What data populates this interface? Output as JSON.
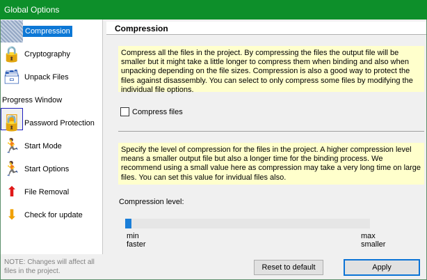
{
  "window": {
    "title": "Global Options"
  },
  "sidebar": {
    "items": [
      {
        "label": "Compression",
        "icon": "compression-icon"
      },
      {
        "label": "Cryptography",
        "icon": "lock-icon"
      },
      {
        "label": "Unpack Files",
        "icon": "unpack-icon"
      },
      {
        "label": "Progress Window",
        "icon": "progress-window-icon"
      },
      {
        "label": "Password Protection",
        "icon": "lock-icon"
      },
      {
        "label": "Start Mode",
        "icon": "running-man-icon"
      },
      {
        "label": "Start Options",
        "icon": "running-man-icon"
      },
      {
        "label": "File Removal",
        "icon": "arrow-up-icon"
      },
      {
        "label": "Check for update",
        "icon": "arrow-down-icon"
      }
    ],
    "selected": "Compression",
    "note": "NOTE: Changes will affect all files in the project."
  },
  "main": {
    "section_title": "Compression",
    "info1": "Compress all the files in the project. By compressing the files the output file will be smaller but it might take a little longer to compress them when binding and also when unpacking depending on the file sizes. Compression is also a good way to protect the files against disassembly. You can select to only compress some files by modifying the individual file options.",
    "compress_checkbox": {
      "label": "Compress files",
      "checked": false
    },
    "info2": "Specify the level of compression for the files in the project. A higher compression level means a smaller output file but also a longer time for the binding process. We recommend using a small value here as compression may take a very long time on large files. You can set this value for invidual files also.",
    "level": {
      "label": "Compression level:",
      "value": 0,
      "min_label": "min",
      "min_sub": "faster",
      "max_label": "max",
      "max_sub": "smaller"
    }
  },
  "footer": {
    "reset_label": "Reset to default",
    "apply_label": "Apply"
  },
  "colors": {
    "titlebar": "#0d8f2a",
    "selection": "#0d78d6",
    "info_background": "#ffffcc",
    "slider_thumb": "#1a7ed8"
  }
}
